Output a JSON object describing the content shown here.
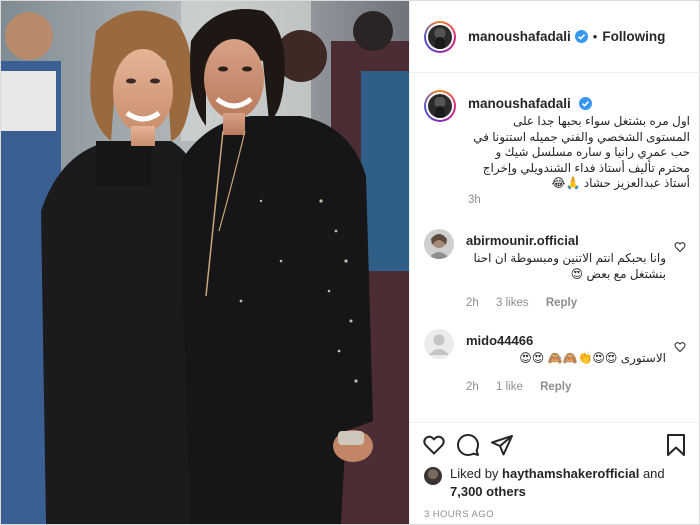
{
  "post": {
    "author": "manoushafadali",
    "follow_status": "Following",
    "separator": "•"
  },
  "caption": {
    "username": "manoushafadali",
    "text": "اول مره بشتغل سواء بحبها جدا على المستوى الشخصي والفني جميله استنونا في حب عمري رانيا و ساره مسلسل شيك و محترم تأليف أستاذ فداء الشندويلي وإخراج أستاذ عبدالعزيز حشاد 🙏😂",
    "time": "3h"
  },
  "comments": [
    {
      "username": "abirmounir.official",
      "text": "وانا بحبكم انتم الاتنين ومبسوطة ان احنا بنشتغل مع بعض 😍",
      "time": "2h",
      "likes": "3 likes",
      "reply": "Reply"
    },
    {
      "username": "mido44466",
      "text": "الاستورى 😍😍👏🙈🙈 😍😍",
      "time": "2h",
      "likes": "1 like",
      "reply": "Reply"
    }
  ],
  "likes": {
    "prefix": "Liked by",
    "user": "haythamshakerofficial",
    "middle": "and",
    "others": "7,300 others"
  },
  "timestamp": "3 hours ago",
  "icons": [
    "heart-icon",
    "comment-icon",
    "share-icon",
    "bookmark-icon",
    "verified-icon",
    "small-heart-icon"
  ],
  "colors": {
    "verified": "#3897f0",
    "muted": "#8e8e8e",
    "text": "#262626"
  }
}
